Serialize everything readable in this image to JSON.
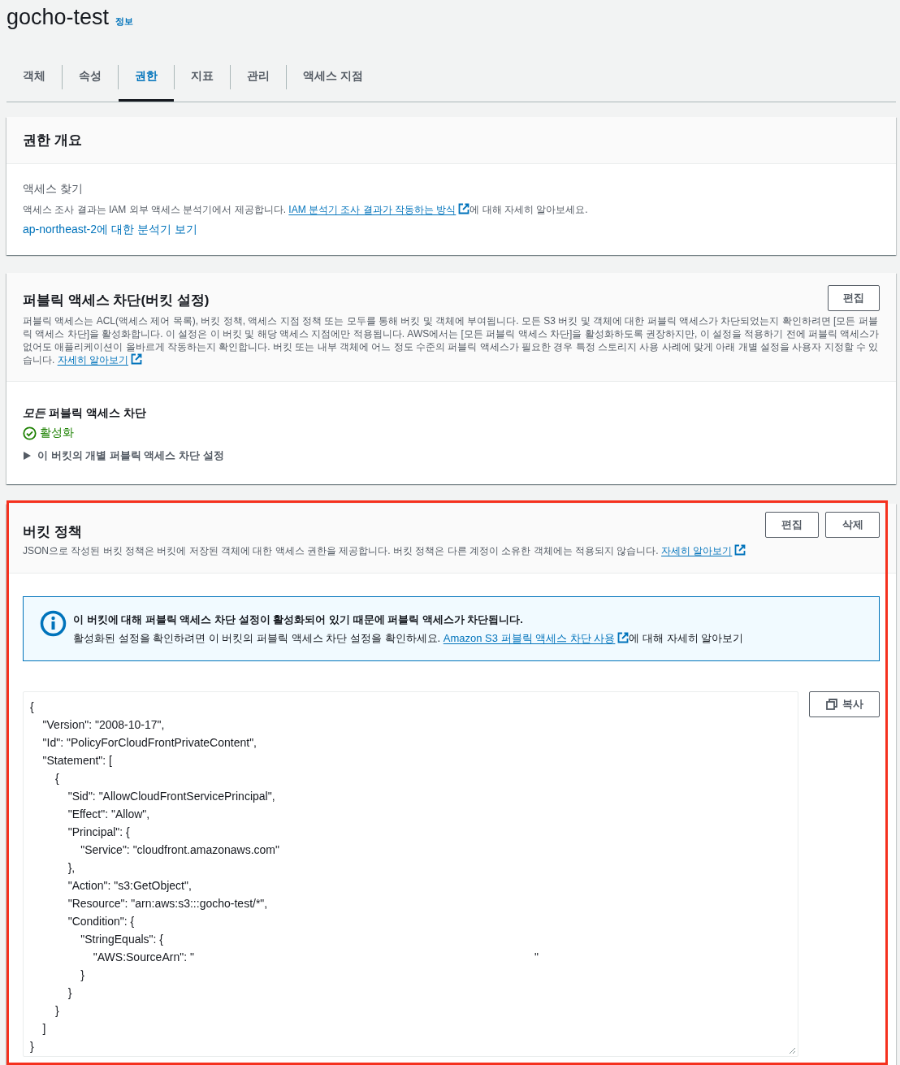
{
  "header": {
    "title": "gocho-test",
    "info_link": "정보"
  },
  "tabs": [
    {
      "label": "객체",
      "selected": false
    },
    {
      "label": "속성",
      "selected": false
    },
    {
      "label": "권한",
      "selected": true
    },
    {
      "label": "지표",
      "selected": false
    },
    {
      "label": "관리",
      "selected": false
    },
    {
      "label": "액세스 지점",
      "selected": false
    }
  ],
  "permissions_overview": {
    "title": "권한 개요",
    "subtitle": "액세스 찾기",
    "description": "액세스 조사 결과는 IAM 외부 액세스 분석기에서 제공합니다. ",
    "description_link": "IAM 분석기 조사 결과가 작동하는 방식",
    "description_suffix": "에 대해 자세히 알아보세요.",
    "analyzer_link": "ap-northeast-2에 대한 분석기 보기"
  },
  "block_public_access": {
    "title": "퍼블릭 액세스 차단(버킷 설정)",
    "edit_button": "편집",
    "description": "퍼블릭 액세스는 ACL(액세스 제어 목록), 버킷 정책, 액세스 지점 정책 또는 모두를 통해 버킷 및 객체에 부여됩니다. 모든 S3 버킷 및 객체에 대한 퍼블릭 액세스가 차단되었는지 확인하려면 [모든 퍼블릭 액세스 차단]을 활성화합니다. 이 설정은 이 버킷 및 해당 액세스 지점에만 적용됩니다. AWS에서는 [모든 퍼블릭 액세스 차단]을 활성화하도록 권장하지만, 이 설정을 적용하기 전에 퍼블릭 액세스가 없어도 애플리케이션이 올바르게 작동하는지 확인합니다. 버킷 또는 내부 객체에 어느 정도 수준의 퍼블릭 액세스가 필요한 경우 특정 스토리지 사용 사례에 맞게 아래 개별 설정을 사용자 지정할 수 있습니다. ",
    "learn_more": "자세히 알아보기",
    "setting_label": "*모든* 퍼블릭 액세스 차단",
    "status": "활성화",
    "status_on": true,
    "details_toggle": {
      "label": "이 버킷의 개별 퍼블릭 액세스 차단 설정",
      "expanded": false
    }
  },
  "bucket_policy": {
    "highlighted": true,
    "title": "버킷 정책",
    "buttons": [
      "편집",
      "삭제"
    ],
    "description": "JSON으로 작성된 버킷 정책은 버킷에 저장된 객체에 대한 액세스 권한을 제공합니다. 버킷 정책은 다른 계정이 소유한 객체에는 적용되지 않습니다. ",
    "learn_more": "자세히 알아보기",
    "alert": {
      "kind": "info",
      "title": "이 버킷에 대해 퍼블릭 액세스 차단 설정이 활성화되어 있기 때문에 퍼블릭 액세스가 차단됩니다.",
      "body": "활성화된 설정을 확인하려면 이 버킷의 퍼블릭 액세스 차단 설정을 확인하세요. ",
      "link": "Amazon S3 퍼블릭 액세스 차단 사용",
      "suffix": "에 대해 자세히 알아보기"
    },
    "copy_button": "복사",
    "policy_lines": [
      {
        "text": "{"
      },
      {
        "text": "    \"Version\": \"2008-10-17\","
      },
      {
        "text": "    \"Id\": \"PolicyForCloudFrontPrivateContent\","
      },
      {
        "text": "    \"Statement\": ["
      },
      {
        "text": "        {"
      },
      {
        "text": "            \"Sid\": \"AllowCloudFrontServicePrincipal\","
      },
      {
        "text": "            \"Effect\": \"Allow\","
      },
      {
        "text": "            \"Principal\": {"
      },
      {
        "text": "                \"Service\": \"cloudfront.amazonaws.com\""
      },
      {
        "text": "            },"
      },
      {
        "text": "            \"Action\": \"s3:GetObject\","
      },
      {
        "text": "            \"Resource\": \"arn:aws:s3:::gocho-test/*\","
      },
      {
        "text": "            \"Condition\": {"
      },
      {
        "text": "                \"StringEquals\": {"
      },
      {
        "text": "                    \"AWS:SourceArn\": \"",
        "tail": "\""
      },
      {
        "text": "                }"
      },
      {
        "text": "            }"
      },
      {
        "text": "        }"
      },
      {
        "text": "    ]"
      },
      {
        "text": "}"
      }
    ]
  }
}
